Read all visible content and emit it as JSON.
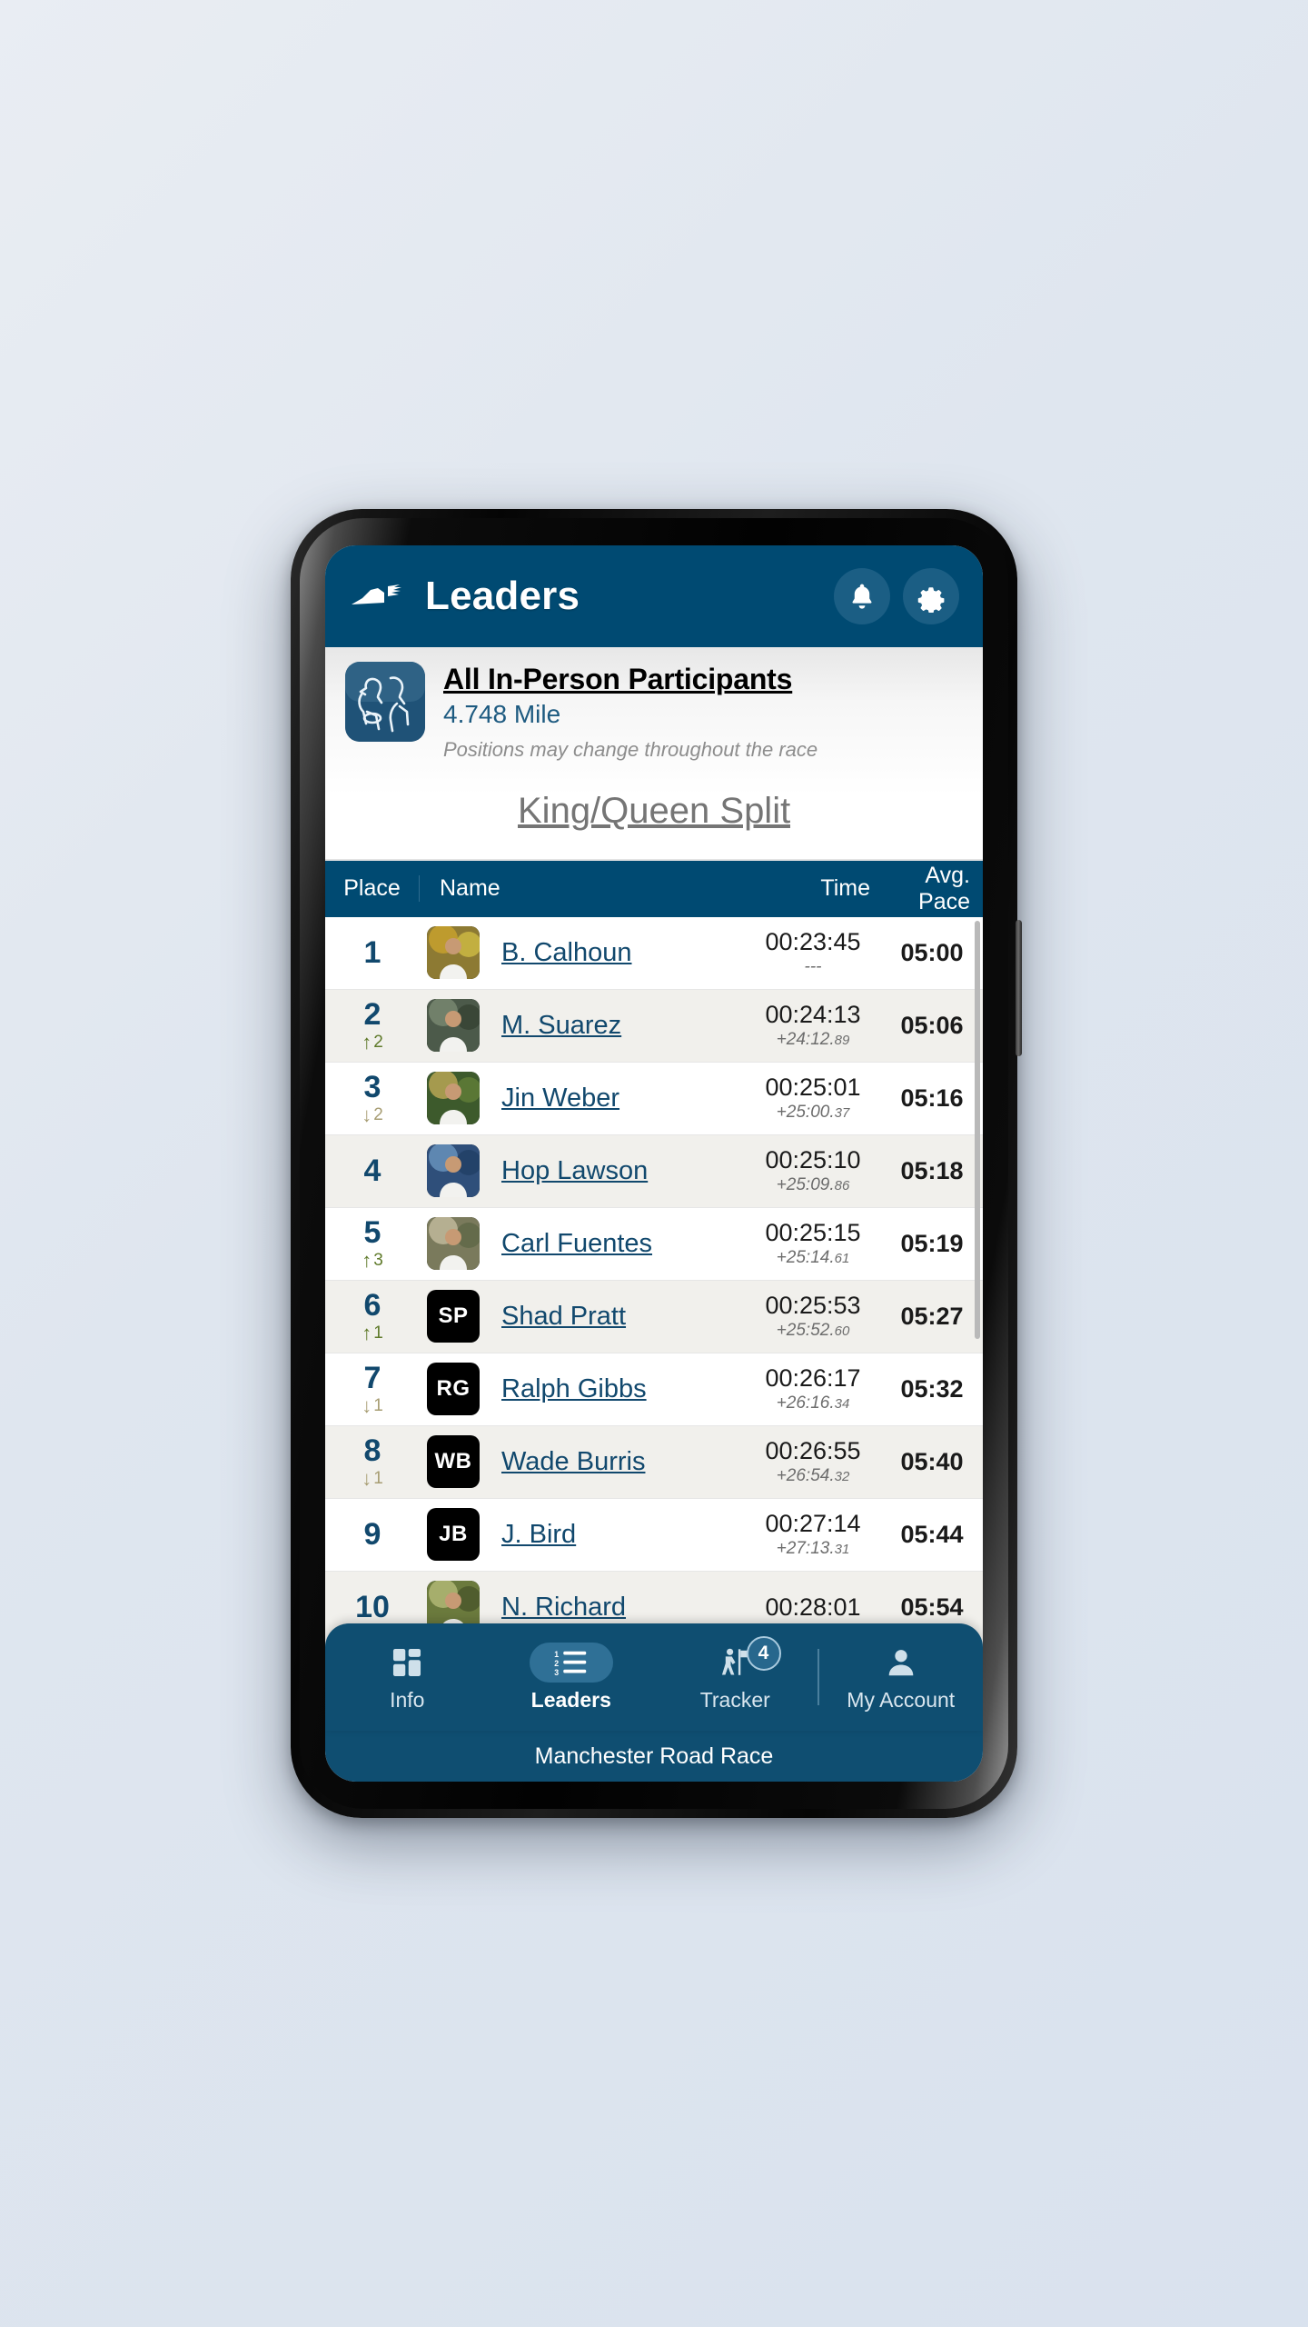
{
  "header": {
    "title": "Leaders",
    "logo_icon": "running-shoe-icon",
    "notifications_icon": "bell-icon",
    "settings_icon": "gear-icon"
  },
  "race_info": {
    "avatar_icon": "two-runners-icon",
    "title": "All In-Person Participants",
    "distance": "4.748 Mile",
    "note": "Positions may change throughout the race",
    "split_selected": "King/Queen Split"
  },
  "table": {
    "columns": {
      "place": "Place",
      "name": "Name",
      "time": "Time",
      "pace": "Avg. Pace"
    },
    "rows": [
      {
        "place": "1",
        "delta": "",
        "delta_dir": "",
        "avatar_type": "photo",
        "avatar_initials": "",
        "photo_a": "#8d7a33",
        "photo_b": "#cfa72e",
        "photo_c": "#e6d24a",
        "name": "B. Calhoun",
        "time": "00:23:45",
        "gap": "---",
        "gap_frac": "",
        "pace": "05:00"
      },
      {
        "place": "2",
        "delta": "2",
        "delta_dir": "up",
        "avatar_type": "photo",
        "avatar_initials": "",
        "photo_a": "#4c5a4a",
        "photo_b": "#7d8d75",
        "photo_c": "#2e3a2c",
        "name": "M. Suarez",
        "time": "00:24:13",
        "gap": "+24:12.",
        "gap_frac": "89",
        "pace": "05:06"
      },
      {
        "place": "3",
        "delta": "2",
        "delta_dir": "down",
        "avatar_type": "photo",
        "avatar_initials": "",
        "photo_a": "#3d5a2c",
        "photo_b": "#c8b05a",
        "photo_c": "#6e8a3c",
        "name": "Jin Weber",
        "time": "00:25:01",
        "gap": "+25:00.",
        "gap_frac": "37",
        "pace": "05:16"
      },
      {
        "place": "4",
        "delta": "",
        "delta_dir": "",
        "avatar_type": "photo",
        "avatar_initials": "",
        "photo_a": "#2f4f7a",
        "photo_b": "#6f9ac4",
        "photo_c": "#1d3b5e",
        "name": "Hop Lawson",
        "time": "00:25:10",
        "gap": "+25:09.",
        "gap_frac": "86",
        "pace": "05:18"
      },
      {
        "place": "5",
        "delta": "3",
        "delta_dir": "up",
        "avatar_type": "photo",
        "avatar_initials": "",
        "photo_a": "#7a7a5c",
        "photo_b": "#c9c2a3",
        "photo_c": "#55613f",
        "name": "Carl Fuentes",
        "time": "00:25:15",
        "gap": "+25:14.",
        "gap_frac": "61",
        "pace": "05:19"
      },
      {
        "place": "6",
        "delta": "1",
        "delta_dir": "up",
        "avatar_type": "initials",
        "avatar_initials": "SP",
        "photo_a": "",
        "photo_b": "",
        "photo_c": "",
        "name": "Shad Pratt",
        "time": "00:25:53",
        "gap": "+25:52.",
        "gap_frac": "60",
        "pace": "05:27"
      },
      {
        "place": "7",
        "delta": "1",
        "delta_dir": "down",
        "avatar_type": "initials",
        "avatar_initials": "RG",
        "photo_a": "",
        "photo_b": "",
        "photo_c": "",
        "name": "Ralph Gibbs",
        "time": "00:26:17",
        "gap": "+26:16.",
        "gap_frac": "34",
        "pace": "05:32"
      },
      {
        "place": "8",
        "delta": "1",
        "delta_dir": "down",
        "avatar_type": "initials",
        "avatar_initials": "WB",
        "photo_a": "",
        "photo_b": "",
        "photo_c": "",
        "name": "Wade Burris",
        "time": "00:26:55",
        "gap": "+26:54.",
        "gap_frac": "32",
        "pace": "05:40"
      },
      {
        "place": "9",
        "delta": "",
        "delta_dir": "",
        "avatar_type": "initials",
        "avatar_initials": "JB",
        "photo_a": "",
        "photo_b": "",
        "photo_c": "",
        "name": "J. Bird",
        "time": "00:27:14",
        "gap": "+27:13.",
        "gap_frac": "31",
        "pace": "05:44"
      },
      {
        "place": "10",
        "delta": "",
        "delta_dir": "",
        "avatar_type": "photo",
        "avatar_initials": "",
        "photo_a": "#6b7a3d",
        "photo_b": "#b9c07c",
        "photo_c": "#3e4a24",
        "name": "N. Richard",
        "time": "00:28:01",
        "gap": "",
        "gap_frac": "",
        "pace": "05:54"
      }
    ]
  },
  "bottom_nav": {
    "items": [
      {
        "label": "Info",
        "icon": "grid-squares-icon",
        "active": false
      },
      {
        "label": "Leaders",
        "icon": "ranked-list-icon",
        "active": true
      },
      {
        "label": "Tracker",
        "icon": "person-flag-icon",
        "active": false,
        "badge": "4"
      },
      {
        "label": "My Account",
        "icon": "person-icon",
        "active": false
      }
    ]
  },
  "footer": {
    "text": "Manchester Road Race"
  },
  "colors": {
    "brand_blue": "#004A72",
    "nav_blue": "#0f4e71",
    "link_blue": "#11486d",
    "up_green": "#5f7a2a",
    "down_tan": "#a79d73"
  }
}
